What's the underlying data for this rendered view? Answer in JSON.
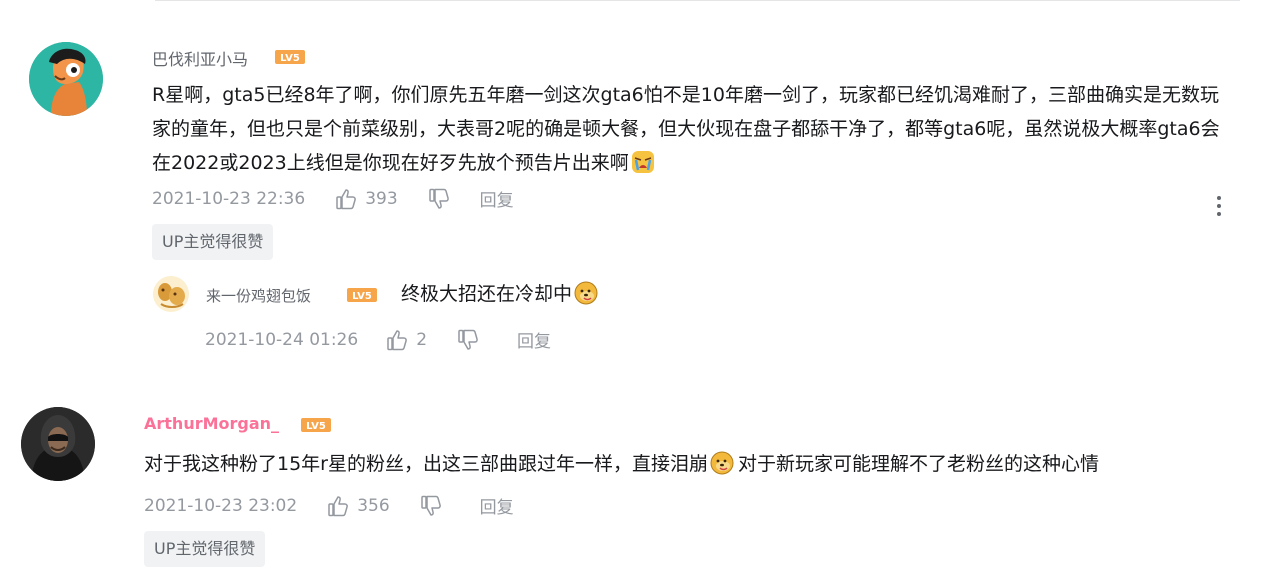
{
  "comments": [
    {
      "username": "巴伐利亚小马",
      "level": "LV5",
      "content_parts": [
        "R星啊，gta5已经8年了啊，你们原先五年磨一剑这次gta6怕不是10年磨一剑了，玩家都已经饥渴难耐了，三部曲确实是无数玩家的童年，但也只是个前菜级别，大表哥2呢的确是顿大餐，但大伙现在盘子都舔干净了，都等gta6呢，虽然说极大概率gta6会在2022或2023上线但是你现在好歹先放个预告片出来啊"
      ],
      "emoji": "crying-emoji",
      "time": "2021-10-23 22:36",
      "likes": "393",
      "reply_label": "回复",
      "up_liked_label": "UP主觉得很赞",
      "replies": [
        {
          "username": "来一份鸡翅包饭",
          "level": "LV5",
          "content": "终极大招还在冷却中",
          "emoji": "doge-emoji",
          "time": "2021-10-24 01:26",
          "likes": "2",
          "reply_label": "回复"
        }
      ]
    },
    {
      "username": "ArthurMorgan_",
      "level": "LV5",
      "content_a": "对于我这种粉了15年r星的粉丝，出这三部曲跟过年一样，直接泪崩",
      "content_b": "对于新玩家可能理解不了老粉丝的这种心情",
      "emoji": "doge-emoji",
      "time": "2021-10-23 23:02",
      "likes": "356",
      "reply_label": "回复",
      "up_liked_label": "UP主觉得很赞"
    }
  ],
  "colors": {
    "vip_name": "#fb7299",
    "level_badge": "#f6a54a",
    "meta_text": "#9499a0",
    "up_liked_bg": "#f1f2f3"
  }
}
